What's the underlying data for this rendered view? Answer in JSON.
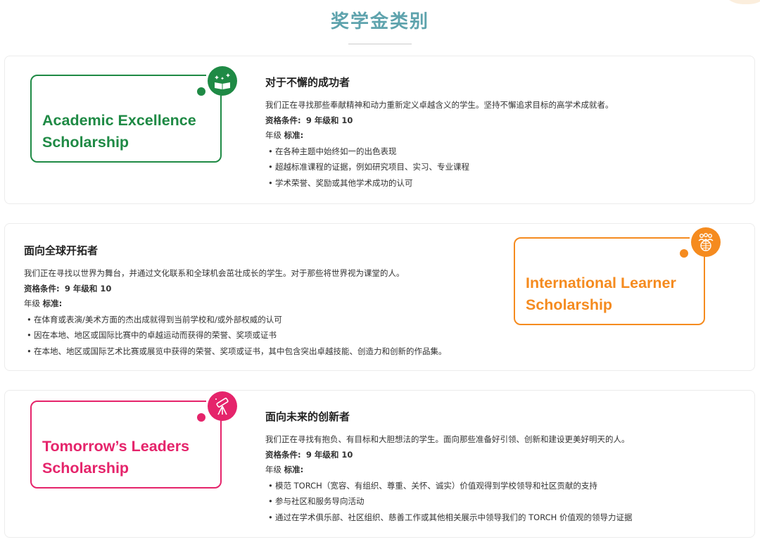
{
  "page_title": "奖学金类别",
  "scholarships": [
    {
      "badge_line1": "Academic Excellence",
      "badge_line2": "Scholarship",
      "icon": "open-book-sparkle-icon",
      "color": "#1f8a45",
      "heading": "对于不懈的成功者",
      "intro": "我们正在寻找那些奉献精神和动力重新定义卓越含义的学生。坚持不懈追求目标的高学术成就者。",
      "eligibility_label": "资格条件:",
      "eligibility_value": "9 年级和 10",
      "criteria_prefix": "年级",
      "criteria_label": "标准:",
      "criteria": [
        "在各种主题中始终如一的出色表现",
        "超越标准课程的证据，例如研究项目、实习、专业课程",
        "学术荣誉、奖励或其他学术成功的认可"
      ]
    },
    {
      "badge_line1": "International Learner",
      "badge_line2": "Scholarship",
      "icon": "globe-people-icon",
      "color": "#f58b1f",
      "heading": "面向全球开拓者",
      "intro": "我们正在寻找以世界为舞台，并通过文化联系和全球机会茁壮成长的学生。对于那些将世界视为课堂的人。",
      "eligibility_label": "资格条件:",
      "eligibility_value": "9 年级和 10",
      "criteria_prefix": "年级",
      "criteria_label": "标准:",
      "criteria": [
        "在体育或表演/美术方面的杰出成就得到当前学校和/或外部权威的认可",
        "因在本地、地区或国际比赛中的卓越运动而获得的荣誉、奖项或证书",
        "在本地、地区或国际艺术比赛或展览中获得的荣誉、奖项或证书，其中包含突出卓越技能、创造力和创新的作品集。"
      ]
    },
    {
      "badge_line1": "Tomorrow’s Leaders",
      "badge_line2": "Scholarship",
      "icon": "telescope-icon",
      "color": "#e5246b",
      "heading": "面向未来的创新者",
      "intro": "我们正在寻找有抱负、有目标和大胆想法的学生。面向那些准备好引领、创新和建设更美好明天的人。",
      "eligibility_label": "资格条件:",
      "eligibility_value": "9 年级和 10",
      "criteria_prefix": "年级",
      "criteria_label": "标准:",
      "criteria": [
        "模范 TORCH（宽容、有组织、尊重、关怀、诚实）价值观得到学校领导和社区贡献的支持",
        "参与社区和服务导向活动",
        "通过在学术俱乐部、社区组织、慈善工作或其他相关展示中领导我们的 TORCH 价值观的领导力证据"
      ]
    }
  ]
}
